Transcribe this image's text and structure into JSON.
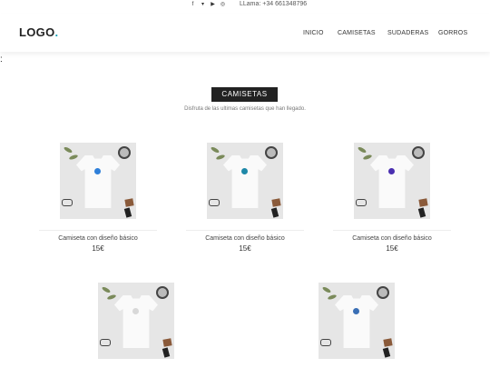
{
  "topbar": {
    "social_icons": [
      "facebook-icon",
      "twitter-icon",
      "youtube-icon",
      "instagram-icon"
    ],
    "phone": "LLama: +34 661348796"
  },
  "header": {
    "logo_text": "LOGO",
    "logo_dot": ".",
    "nav": [
      "INICIO",
      "CAMISETAS",
      "SUDADERAS",
      "GORROS"
    ]
  },
  "stray_text": ":",
  "section": {
    "title": "CAMISETAS",
    "subtitle": "Disfruta de las ultimas camisetas que han llegado."
  },
  "products": [
    {
      "name": "Camiseta con diseño básico",
      "price": "15€",
      "emblem_color": "#2f7fd9"
    },
    {
      "name": "Camiseta con diseño básico",
      "price": "15€",
      "emblem_color": "#1e88a8"
    },
    {
      "name": "Camiseta con diseño básico",
      "price": "15€",
      "emblem_color": "#4a2fb0"
    },
    {
      "name": "",
      "price": "",
      "emblem_color": "#d8d8d8"
    },
    {
      "name": "",
      "price": "",
      "emblem_color": "#3a6fb5"
    }
  ]
}
